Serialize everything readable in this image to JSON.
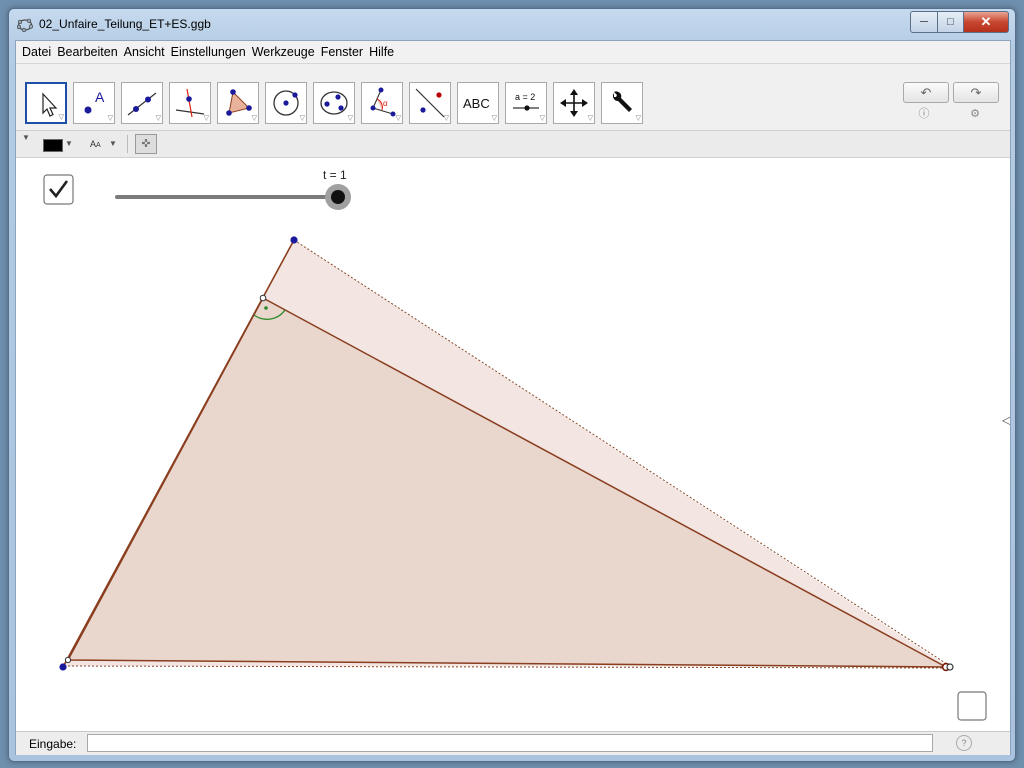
{
  "window": {
    "title": "02_Unfaire_Teilung_ET+ES.ggb"
  },
  "menu": [
    "Datei",
    "Bearbeiten",
    "Ansicht",
    "Einstellungen",
    "Werkzeuge",
    "Fenster",
    "Hilfe"
  ],
  "toolbar": {
    "tools": [
      "move-tool",
      "point-tool",
      "line-tool",
      "perpendicular-line-tool",
      "polygon-tool",
      "circle-tool",
      "conic-tool",
      "angle-tool",
      "reflect-tool",
      "text-tool",
      "slider-tool",
      "move-graphics-view-tool",
      "general-tools"
    ],
    "text_tool_label": "ABC",
    "slider_tool_label": "a = 2"
  },
  "canvas": {
    "slider_label": "t = 1",
    "slider_value": 1,
    "checkbox_checked": true
  },
  "input_bar": {
    "label": "Eingabe:",
    "value": "",
    "placeholder": ""
  },
  "colors": {
    "triangle_outer_fill": "#f2e3df",
    "triangle_inner_fill": "#e9d7cf",
    "edge": "#8a3e1f",
    "vertex": "#1a1a9a",
    "angle_mark": "#1a7a1a"
  }
}
